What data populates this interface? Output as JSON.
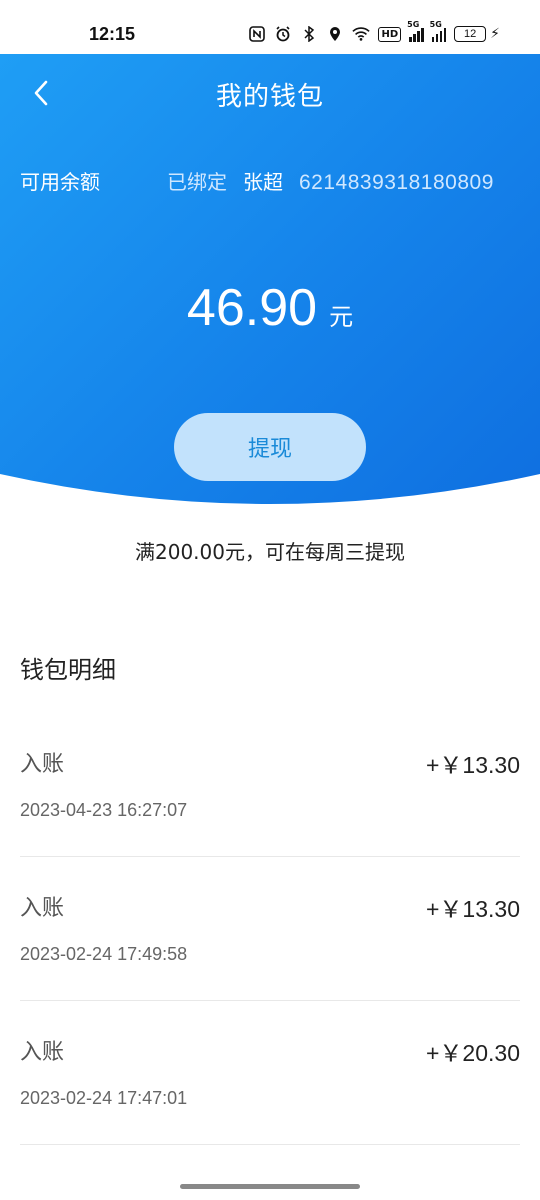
{
  "status_bar": {
    "time": "12:15",
    "icons": [
      "nfc-icon",
      "alarm-icon",
      "bluetooth-icon",
      "location-icon",
      "wifi-icon",
      "hd-icon",
      "signal-5g-icon",
      "signal-5g-icon"
    ],
    "hd_label": "HD",
    "net_label": "5G",
    "battery": "12"
  },
  "header": {
    "title": "我的钱包",
    "available_label": "可用余额",
    "bound_status": "已绑定",
    "bound_name": "张超",
    "bound_card": "6214839318180809",
    "amount": "46.90",
    "unit": "元",
    "withdraw_label": "提现",
    "gradient": [
      "#1f9ef5",
      "#0f6fe0"
    ]
  },
  "notice": "满200.00元，可在每周三提现",
  "detail": {
    "title": "钱包明细",
    "items": [
      {
        "type": "入账",
        "amount": "+￥13.30",
        "time": "2023-04-23 16:27:07"
      },
      {
        "type": "入账",
        "amount": "+￥13.30",
        "time": "2023-02-24 17:49:58"
      },
      {
        "type": "入账",
        "amount": "+￥20.30",
        "time": "2023-02-24 17:47:01"
      }
    ]
  }
}
